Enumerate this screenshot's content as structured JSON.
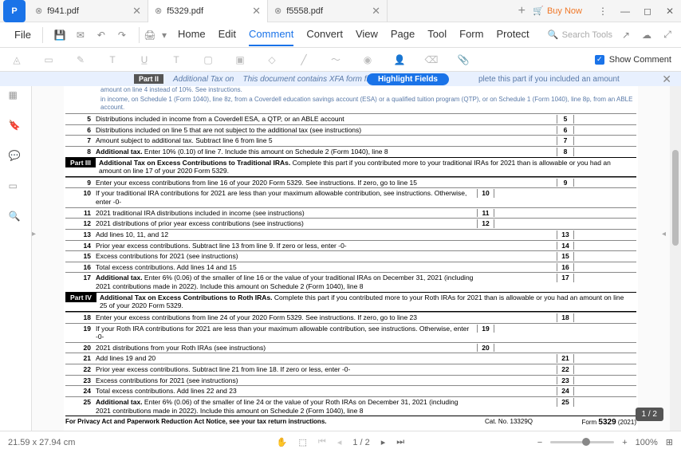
{
  "app": {
    "tabs": [
      {
        "name": "f941.pdf",
        "active": false
      },
      {
        "name": "f5329.pdf",
        "active": true
      },
      {
        "name": "f5558.pdf",
        "active": false
      }
    ],
    "buy_now": "Buy Now",
    "file_menu": "File",
    "menu_items": [
      "Home",
      "Edit",
      "Comment",
      "Convert",
      "View",
      "Page",
      "Tool",
      "Form",
      "Protect"
    ],
    "active_menu": "Comment",
    "search_placeholder": "Search Tools",
    "show_comment": "Show Comment"
  },
  "banner": {
    "part": "Part II",
    "label1": "Additional Tax on",
    "label2": "This document contains XFA form fields.",
    "button": "Highlight Fields",
    "tail": "plete this part if you included an amount"
  },
  "doc": {
    "cont1": "amount on line 4 instead of 10%. See instructions.",
    "cont2": "in income, on Schedule 1 (Form 1040), line 8z, from a Coverdell education savings account (ESA) or a qualified tuition program (QTP), or on Schedule 1 (Form 1040), line 8p, from an ABLE account.",
    "rows_a": [
      {
        "n": "5",
        "t": "Distributions included in income from a Coverdell ESA, a QTP, or an ABLE account",
        "box": "5"
      },
      {
        "n": "6",
        "t": "Distributions included on line 5 that are not subject to the additional tax (see instructions)",
        "box": "6"
      },
      {
        "n": "7",
        "t": "Amount subject to additional tax. Subtract line 6 from line 5",
        "box": "7"
      },
      {
        "n": "8",
        "t": "Additional tax. Enter 10% (0.10) of line 7. Include this amount on Schedule 2 (Form 1040), line 8",
        "bold_prefix": "Additional tax.",
        "box": "8"
      }
    ],
    "part3": {
      "label": "Part III",
      "title": "Additional Tax on Excess Contributions to Traditional IRAs.",
      "desc": "Complete this part if you contributed more to your traditional IRAs for 2021 than is allowable or you had an amount on line 17 of your 2020 Form 5329."
    },
    "rows_b": [
      {
        "n": "9",
        "t": "Enter your excess contributions from line 16 of your 2020 Form 5329. See instructions. If zero, go to line 15",
        "box": "9",
        "rightcol": true
      },
      {
        "n": "10",
        "t": "If your traditional IRA contributions for 2021 are less than your maximum allowable contribution, see instructions. Otherwise, enter -0-",
        "box": "10",
        "midcol": true
      },
      {
        "n": "11",
        "t": "2021 traditional IRA distributions included in income (see instructions)",
        "box": "11",
        "midcol": true
      },
      {
        "n": "12",
        "t": "2021 distributions of prior year excess contributions (see instructions)",
        "box": "12",
        "midcol": true
      },
      {
        "n": "13",
        "t": "Add lines 10, 11, and 12",
        "box": "13",
        "rightcol": true
      },
      {
        "n": "14",
        "t": "Prior year excess contributions. Subtract line 13 from line 9. If zero or less, enter -0-",
        "box": "14",
        "rightcol": true
      },
      {
        "n": "15",
        "t": "Excess contributions for 2021 (see instructions)",
        "box": "15",
        "rightcol": true
      },
      {
        "n": "16",
        "t": "Total excess contributions. Add lines 14 and 15",
        "box": "16",
        "rightcol": true
      },
      {
        "n": "17",
        "t": "Additional tax. Enter 6% (0.06) of the smaller of line 16 or the value of your traditional IRAs on December 31, 2021 (including 2021 contributions made in 2022). Include this amount on Schedule 2 (Form 1040), line 8",
        "bold_prefix": "Additional tax.",
        "box": "17",
        "rightcol": true
      }
    ],
    "part4": {
      "label": "Part IV",
      "title": "Additional Tax on Excess Contributions to Roth IRAs.",
      "desc": "Complete this part if you contributed more to your Roth IRAs for 2021 than is allowable or you had an amount on line 25 of your 2020 Form 5329."
    },
    "rows_c": [
      {
        "n": "18",
        "t": "Enter your excess contributions from line 24 of your 2020 Form 5329. See instructions. If zero, go to line 23",
        "box": "18",
        "rightcol": true
      },
      {
        "n": "19",
        "t": "If your Roth IRA contributions for 2021 are less than your maximum allowable contribution, see instructions. Otherwise, enter -0-",
        "box": "19",
        "midcol": true
      },
      {
        "n": "20",
        "t": "2021 distributions from your Roth IRAs (see instructions)",
        "box": "20",
        "midcol": true
      },
      {
        "n": "21",
        "t": "Add lines 19 and 20",
        "box": "21",
        "rightcol": true
      },
      {
        "n": "22",
        "t": "Prior year excess contributions. Subtract line 21 from line 18. If zero or less, enter -0-",
        "box": "22",
        "rightcol": true
      },
      {
        "n": "23",
        "t": "Excess contributions for 2021 (see instructions)",
        "box": "23",
        "rightcol": true
      },
      {
        "n": "24",
        "t": "Total excess contributions. Add lines 22 and 23",
        "box": "24",
        "rightcol": true
      },
      {
        "n": "25",
        "t": "Additional tax. Enter 6% (0.06) of the smaller of line 24 or the value of your Roth IRAs on December 31, 2021 (including 2021 contributions made in 2022). Include this amount on Schedule 2 (Form 1040), line 8",
        "bold_prefix": "Additional tax.",
        "box": "25",
        "rightcol": true
      }
    ],
    "privacy": "For Privacy Act and Paperwork Reduction Act Notice, see your tax return instructions.",
    "catno": "Cat. No. 13329Q",
    "formno": "Form 5329 (2021)"
  },
  "status": {
    "dims": "21.59 x 27.94 cm",
    "page_current": "1",
    "page_total": "/ 2",
    "page_badge": "1 / 2",
    "zoom": "100%"
  }
}
